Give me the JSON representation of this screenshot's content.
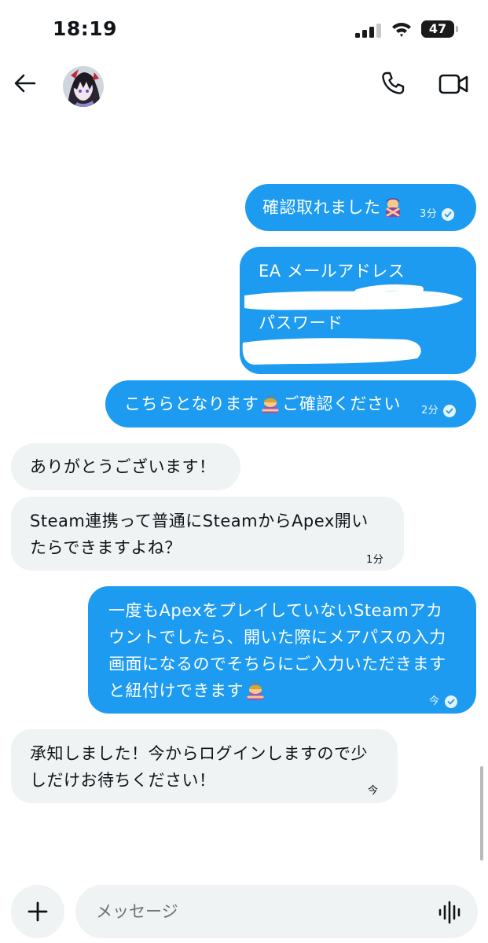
{
  "status_bar": {
    "time": "18:19",
    "battery_level": "47",
    "battery_fraction": 0.47
  },
  "header": {
    "back_icon": "arrow-left-icon",
    "call_icon": "phone-icon",
    "video_icon": "video-camera-icon"
  },
  "messages": [
    {
      "direction": "outgoing",
      "text": "確認取れました",
      "emoji": "person-gesturing-no",
      "time": "3分",
      "read": true
    },
    {
      "direction": "outgoing",
      "lines": [
        "EA メールアドレス",
        "パスワード"
      ],
      "redacted": true
    },
    {
      "direction": "outgoing",
      "text_before": "こちらとなります",
      "emoji": "person-bowing",
      "text_after": "ご確認ください",
      "time": "2分",
      "read": true
    },
    {
      "direction": "incoming",
      "text": "ありがとうございます！"
    },
    {
      "direction": "incoming",
      "lines": [
        "Steam連携って普通にSteamからApex開い",
        "たらできますよね？"
      ],
      "time": "1分"
    },
    {
      "direction": "outgoing",
      "lines": [
        "一度もApexをプレイしていないSteamアカ",
        "ウントでしたら、開いた際にメアパスの入力",
        "画面になるのでそちらにご入力いただきます",
        "と紐付けできます"
      ],
      "emoji": "person-bowing",
      "time": "今",
      "read": true
    },
    {
      "direction": "incoming",
      "lines": [
        "承知しました！今からログインしますので少",
        "しだけお待ちください！"
      ],
      "time": "今"
    }
  ],
  "composer": {
    "placeholder": "メッセージ",
    "plus_icon": "plus-icon",
    "voice_icon": "voice-waveform-icon"
  },
  "colors": {
    "outgoing_bubble": "#1d9bf0",
    "incoming_bubble": "#eff3f4",
    "text": "#0f1419"
  }
}
